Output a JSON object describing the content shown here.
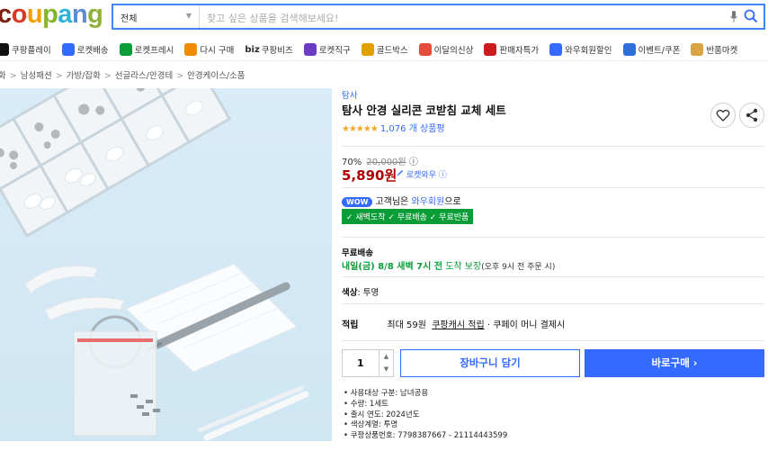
{
  "logo": {
    "letters": [
      "c",
      "o",
      "u",
      "p",
      "a",
      "n",
      "g"
    ],
    "colors": [
      "#7b1f12",
      "#d83a23",
      "#f4a100",
      "#86b42a",
      "#2fb2d4",
      "#5e8ccf",
      "#8fb23a"
    ]
  },
  "search": {
    "category": "전체",
    "placeholder": "찾고 싶은 상품을 검색해보세요!"
  },
  "nav": [
    {
      "label": "쿠팡플레이",
      "icon": "play-icon",
      "color": "#111"
    },
    {
      "label": "로켓배송",
      "icon": "rocket-icon",
      "color": "#346aff"
    },
    {
      "label": "로켓프레시",
      "icon": "rocket-fresh-icon",
      "color": "#0a9d37"
    },
    {
      "label": "다시 구매",
      "icon": "house-icon",
      "color": "#f08c00"
    },
    {
      "label": "쿠팡비즈",
      "icon": "biz-icon",
      "color": "#2b2b2b",
      "prefix": "biz"
    },
    {
      "label": "로켓직구",
      "icon": "global-icon",
      "color": "#6d3cc7"
    },
    {
      "label": "골드박스",
      "icon": "gift-icon",
      "color": "#e0a100"
    },
    {
      "label": "이달의신상",
      "icon": "new-icon",
      "color": "#e64c3c"
    },
    {
      "label": "판매자특가",
      "icon": "percent-icon",
      "color": "#cc1b1b"
    },
    {
      "label": "와우회원할인",
      "icon": "wow-icon",
      "color": "#346aff"
    },
    {
      "label": "이벤트/쿠폰",
      "icon": "coupon-icon",
      "color": "#2d6fd9"
    },
    {
      "label": "반품마켓",
      "icon": "box-icon",
      "color": "#d9a441"
    }
  ],
  "breadcrumb": [
    "화",
    "남성패션",
    "가방/잡화",
    "선글라스/안경테",
    "안경케이스/소품"
  ],
  "product": {
    "brand": "탐사",
    "title": "탐사 안경 실리콘 코받침 교체 세트",
    "stars": "★★★★★",
    "reviews": "1,076 개 상품평",
    "discount": "70%",
    "original_price": "20,000원",
    "info_mark": "ⓘ",
    "price": "5,890원",
    "rocket_wow": "로켓와우",
    "wow_badge": "WOW",
    "wow_prefix": "고객님은",
    "wow_member": "와우회원",
    "wow_suffix": "으로",
    "benefits": "✓ 새벽도착 ✓ 무료배송 ✓ 무료반품",
    "shipping_label": "무료배송",
    "delivery_date": "내일(금) 8/8 새벽 7시 전",
    "delivery_guarantee": "도착 보장",
    "delivery_note": "(오후 9시 전 주문 시)",
    "color_label": "색상",
    "color_value": "투명",
    "reward_label": "적립",
    "reward_text": "최대 59원",
    "reward_link": "쿠팡캐시 적립",
    "reward_suffix": "· 쿠페이 머니 결제시",
    "quantity": "1",
    "cart_label": "장바구니 담기",
    "buy_label": "바로구매 ›",
    "specs": [
      "사용대상 구분: 남녀공용",
      "수량: 1세트",
      "출시 연도: 2024년도",
      "색상계열: 투명",
      "쿠팡상품번호: 7798387667 - 21114443599"
    ]
  }
}
